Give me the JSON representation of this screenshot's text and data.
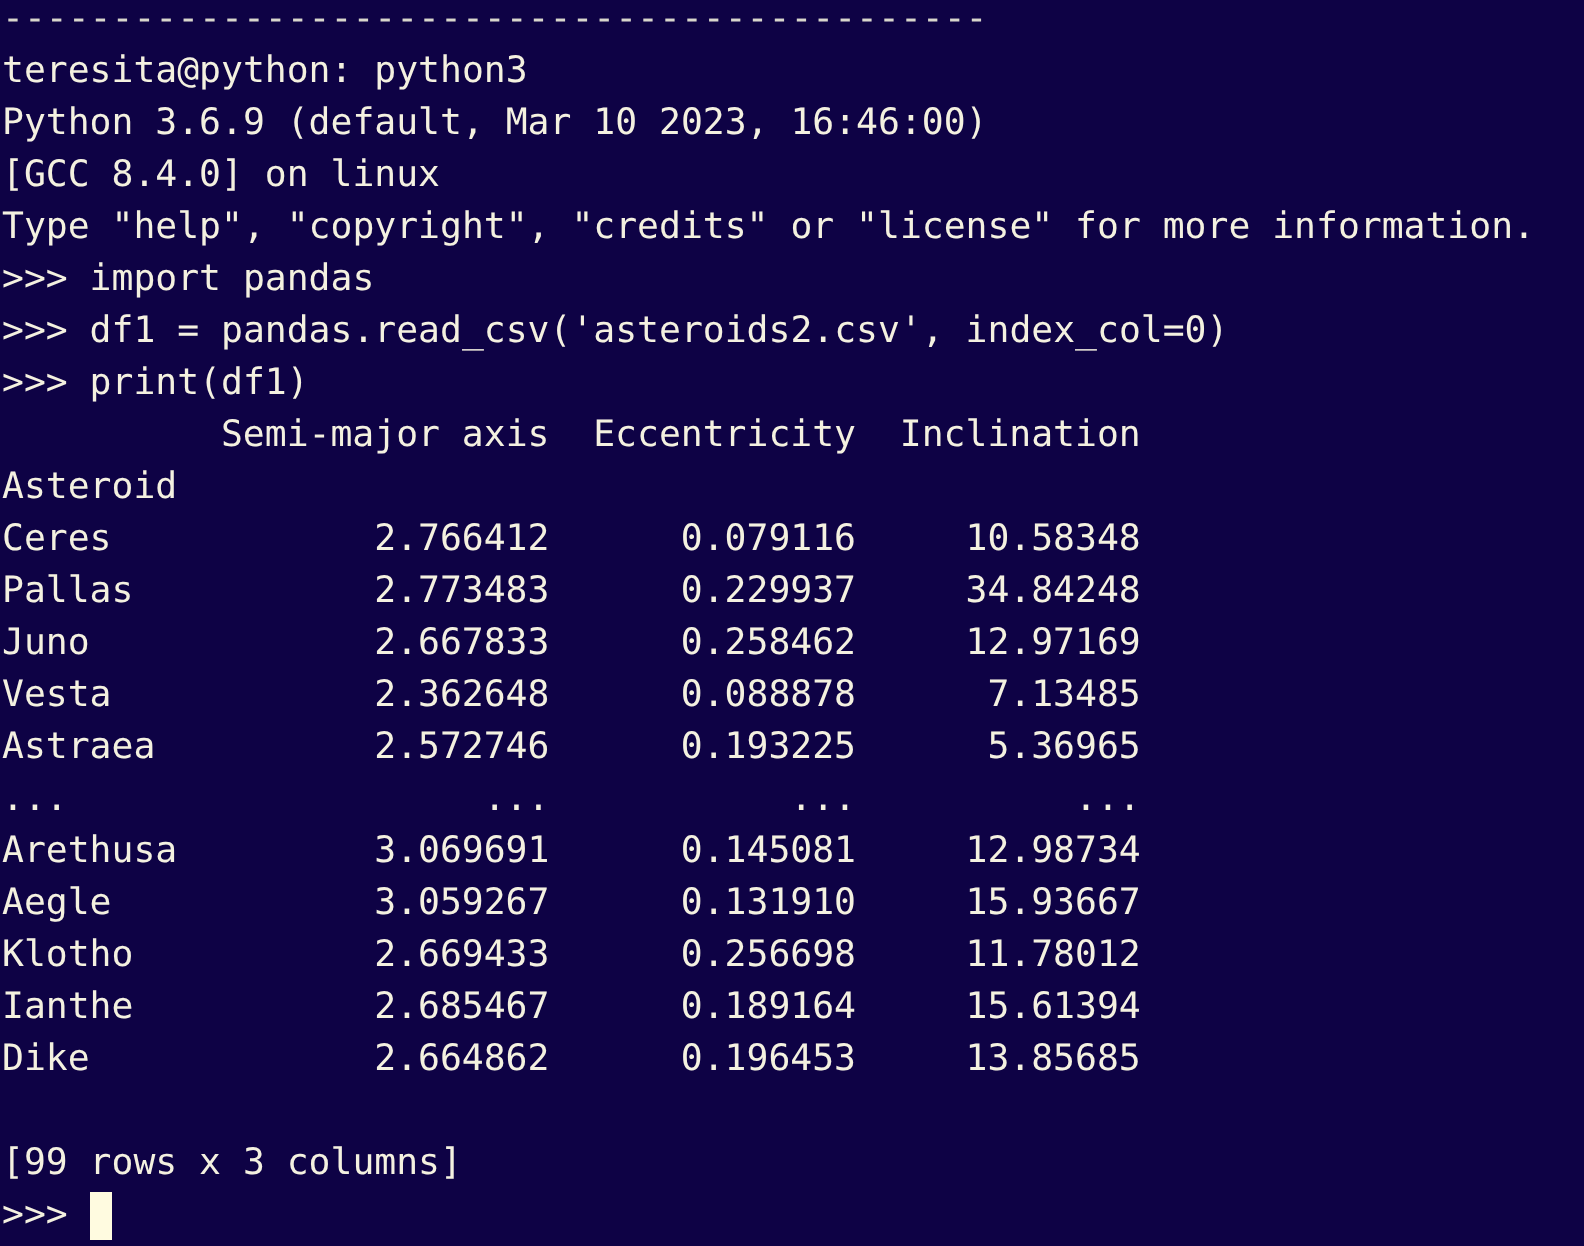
{
  "terminal": {
    "lines": [
      {
        "kind": "rule",
        "text": "---------------------------------------------"
      },
      {
        "kind": "output",
        "text": "teresita@python: python3"
      },
      {
        "kind": "output",
        "text": "Python 3.6.9 (default, Mar 10 2023, 16:46:00)"
      },
      {
        "kind": "output",
        "text": "[GCC 8.4.0] on linux"
      },
      {
        "kind": "output",
        "text": "Type \"help\", \"copyright\", \"credits\" or \"license\" for more information."
      },
      {
        "kind": "input",
        "text": ">>> import pandas"
      },
      {
        "kind": "input",
        "text": ">>> df1 = pandas.read_csv('asteroids2.csv', index_col=0)"
      },
      {
        "kind": "input",
        "text": ">>> print(df1)"
      }
    ],
    "dataframe": {
      "columns": [
        "Semi-major axis",
        "Eccentricity",
        "Inclination"
      ],
      "index_name": "Asteroid",
      "rows": [
        {
          "name": "Ceres",
          "values": [
            "2.766412",
            "0.079116",
            "10.58348"
          ]
        },
        {
          "name": "Pallas",
          "values": [
            "2.773483",
            "0.229937",
            "34.84248"
          ]
        },
        {
          "name": "Juno",
          "values": [
            "2.667833",
            "0.258462",
            "12.97169"
          ]
        },
        {
          "name": "Vesta",
          "values": [
            "2.362648",
            "0.088878",
            "7.13485"
          ]
        },
        {
          "name": "Astraea",
          "values": [
            "2.572746",
            "0.193225",
            "5.36965"
          ]
        },
        {
          "name": "...",
          "values": [
            "...",
            "...",
            "..."
          ]
        },
        {
          "name": "Arethusa",
          "values": [
            "3.069691",
            "0.145081",
            "12.98734"
          ]
        },
        {
          "name": "Aegle",
          "values": [
            "3.059267",
            "0.131910",
            "15.93667"
          ]
        },
        {
          "name": "Klotho",
          "values": [
            "2.669433",
            "0.256698",
            "11.78012"
          ]
        },
        {
          "name": "Ianthe",
          "values": [
            "2.685467",
            "0.189164",
            "15.61394"
          ]
        },
        {
          "name": "Dike",
          "values": [
            "2.664862",
            "0.196453",
            "13.85685"
          ]
        }
      ],
      "shape": "[99 rows x 3 columns]"
    },
    "prompt": ">>>"
  }
}
